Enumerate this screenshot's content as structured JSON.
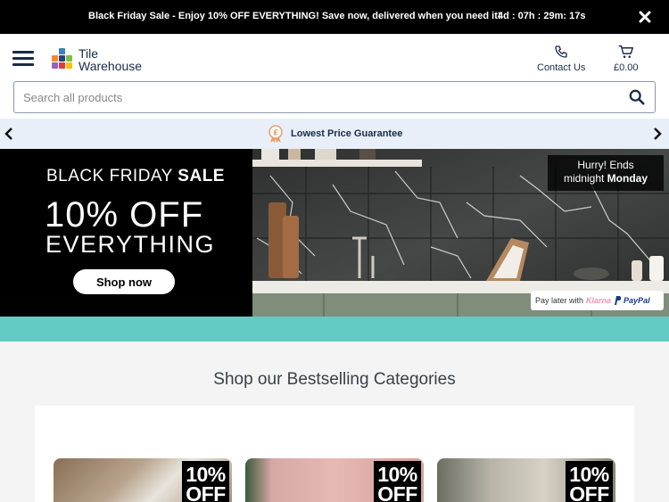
{
  "promo_bar": {
    "message": "Black Friday Sale - Enjoy 10% OFF EVERYTHING! Save now, delivered when you need it!",
    "countdown": "4d : 07h : 29m: 17s"
  },
  "header": {
    "logo_line1": "Tile",
    "logo_line2": "Warehouse",
    "contact_label": "Contact Us",
    "cart_total": "£0.00"
  },
  "search": {
    "placeholder": "Search all products",
    "value": ""
  },
  "usp": {
    "label": "Lowest Price Guarantee"
  },
  "hero": {
    "line1_prefix": "BLACK FRIDAY ",
    "line1_bold": "SALE",
    "line2": "10% OFF",
    "line3": "EVERYTHING",
    "cta": "Shop now",
    "hurry_line1": "Hurry! Ends",
    "hurry_line2_prefix": "midnight ",
    "hurry_line2_bold": "Monday",
    "pay_later_text": "Pay later with",
    "klarna": "Klarna",
    "paypal": "PayPal"
  },
  "categories": {
    "title": "Shop our Bestselling Categories",
    "cards": [
      {
        "badge_line1": "10%",
        "badge_line2": "OFF"
      },
      {
        "badge_line1": "10%",
        "badge_line2": "OFF"
      },
      {
        "badge_line1": "10%",
        "badge_line2": "OFF"
      }
    ]
  },
  "colors": {
    "brand_navy": "#1a2a4a",
    "usp_bg": "#e9eff8",
    "teal": "#63cbc4",
    "promo_bg": "#000000"
  },
  "icons": {
    "menu": "hamburger-icon",
    "contact": "phone-icon",
    "cart": "cart-icon",
    "search": "search-icon",
    "close": "close-icon",
    "usp": "price-medal-icon",
    "prev": "chevron-left-icon",
    "next": "chevron-right-icon"
  }
}
